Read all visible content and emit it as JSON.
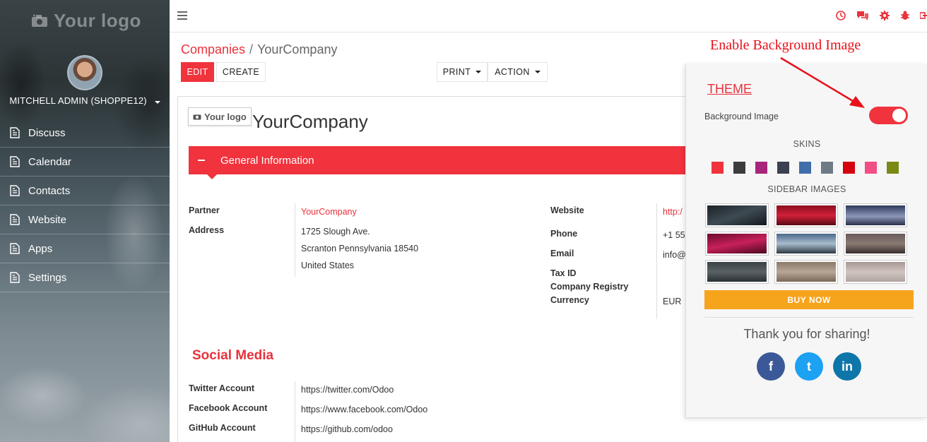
{
  "sidebar": {
    "logo_text": "Your logo",
    "user_name": "MITCHELL ADMIN (SHOPPE12)",
    "items": [
      {
        "label": "Discuss"
      },
      {
        "label": "Calendar"
      },
      {
        "label": "Contacts"
      },
      {
        "label": "Website"
      },
      {
        "label": "Apps"
      },
      {
        "label": "Settings"
      }
    ]
  },
  "breadcrumb": {
    "parent": "Companies",
    "separator": "/",
    "current": "YourCompany"
  },
  "toolbar": {
    "edit_label": "EDIT",
    "create_label": "CREATE",
    "print_label": "PRINT",
    "action_label": "ACTION"
  },
  "form": {
    "logo_text": "Your logo",
    "company_name": "YourCompany",
    "section_title": "General Information",
    "left_fields": {
      "partner_label": "Partner",
      "partner_value": "YourCompany",
      "address_label": "Address",
      "address_line1": "1725 Slough Ave.",
      "address_line2": "Scranton  Pennsylvania  18540",
      "address_line3": "United States"
    },
    "right_fields": {
      "website_label": "Website",
      "website_value": "http:/",
      "phone_label": "Phone",
      "phone_value": "+1 55",
      "email_label": "Email",
      "email_value": "info@",
      "taxid_label": "Tax ID",
      "registry_label": "Company Registry",
      "currency_label": "Currency",
      "currency_value": "EUR"
    },
    "social_title": "Social Media",
    "social": [
      {
        "label": "Twitter Account",
        "value": "https://twitter.com/Odoo"
      },
      {
        "label": "Facebook Account",
        "value": "https://www.facebook.com/Odoo"
      },
      {
        "label": "GitHub Account",
        "value": "https://github.com/odoo"
      }
    ]
  },
  "annotation": "Enable Background Image",
  "theme_panel": {
    "title": "THEME",
    "bg_image_label": "Background Image",
    "bg_image_enabled": true,
    "skins_title": "SKINS",
    "skins": [
      "#f0333d",
      "#3c3c3c",
      "#a8257c",
      "#3a4150",
      "#3f6ea8",
      "#6e7b87",
      "#d4000d",
      "#f24e86",
      "#7b8a14"
    ],
    "sidebar_images_title": "SIDEBAR IMAGES",
    "buy_label": "BUY NOW",
    "thanks_text": "Thank you for sharing!",
    "share": [
      {
        "icon": "facebook-icon",
        "glyph": "f",
        "color": "#3b5998"
      },
      {
        "icon": "twitter-icon",
        "glyph": "t",
        "color": "#1da1f2"
      },
      {
        "icon": "linkedin-icon",
        "glyph": "in",
        "color": "#0e76a8"
      }
    ]
  },
  "colors": {
    "accent": "#f0333d",
    "buy": "#f7a41d"
  }
}
